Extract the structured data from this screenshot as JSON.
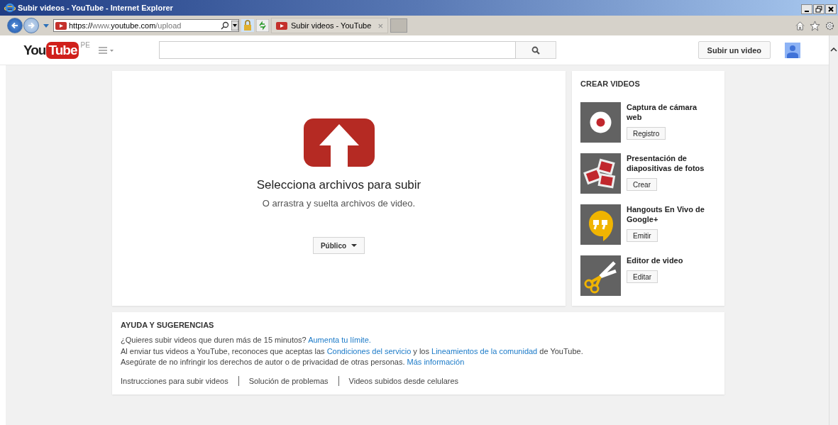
{
  "window": {
    "title": "Subir videos - YouTube - Internet Explorer"
  },
  "browser": {
    "url_scheme": "https://",
    "url_host_prefix": "www.",
    "url_host": "youtube.com",
    "url_path": "/upload",
    "tab_title": "Subir videos - YouTube",
    "tab_close": "×"
  },
  "header": {
    "logo_you": "You",
    "logo_tube": "Tube",
    "region": "PE",
    "upload_button": "Subir un video"
  },
  "upload": {
    "title": "Selecciona archivos para subir",
    "subtitle": "O arrastra y suelta archivos de video.",
    "privacy": "Público"
  },
  "create": {
    "heading": "CREAR VIDEOS",
    "items": [
      {
        "kind": "webcam",
        "title": "Captura de cámara web",
        "button": "Registro"
      },
      {
        "kind": "slideshow",
        "title": "Presentación de diapositivas de fotos",
        "button": "Crear"
      },
      {
        "kind": "hangouts",
        "title": "Hangouts En Vivo de Google+",
        "button": "Emitir"
      },
      {
        "kind": "editor",
        "title": "Editor de video",
        "button": "Editar"
      }
    ]
  },
  "help": {
    "heading": "AYUDA Y SUGERENCIAS",
    "paragraphs": [
      [
        {
          "text": "¿Quieres subir videos que duren más de 15 minutos? ",
          "link": false
        },
        {
          "text": "Aumenta tu límite.",
          "link": true
        }
      ],
      [
        {
          "text": "Al enviar tus videos a YouTube, reconoces que aceptas las ",
          "link": false
        },
        {
          "text": "Condiciones del servicio",
          "link": true
        },
        {
          "text": " y los ",
          "link": false
        },
        {
          "text": "Lineamientos de la comunidad",
          "link": true
        },
        {
          "text": " de YouTube.",
          "link": false
        }
      ],
      [
        {
          "text": "Asegúrate de no infringir los derechos de autor o de privacidad de otras personas. ",
          "link": false
        },
        {
          "text": "Más información",
          "link": true
        }
      ]
    ],
    "links": [
      "Instrucciones para subir videos",
      "Solución de problemas",
      "Videos subidos desde celulares"
    ]
  }
}
